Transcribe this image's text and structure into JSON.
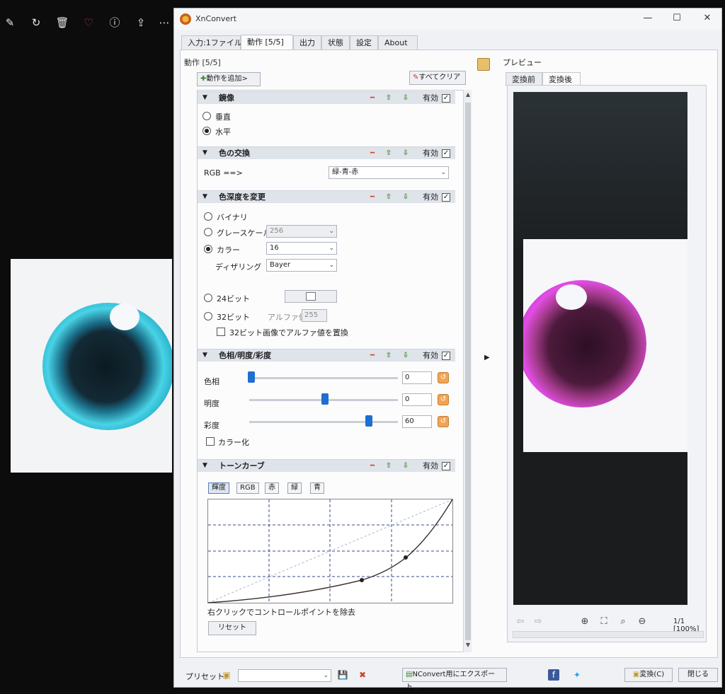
{
  "viewer": {
    "toolbar": [
      {
        "name": "edit-icon",
        "glyph": "✎"
      },
      {
        "name": "rotate-icon",
        "glyph": "↻"
      },
      {
        "name": "delete-icon",
        "glyph": "🗑"
      },
      {
        "name": "favorite-icon",
        "glyph": "♡"
      },
      {
        "name": "info-icon",
        "glyph": "ⓘ"
      },
      {
        "name": "share-icon",
        "glyph": "⇪"
      },
      {
        "name": "more-icon",
        "glyph": "⋯"
      }
    ]
  },
  "window": {
    "title": "XnConvert",
    "controls": {
      "minimize": "—",
      "maximize": "☐",
      "close": "✕"
    }
  },
  "tabs": [
    "入力:1ファイル",
    "動作 [5/5]",
    "出力",
    "状態",
    "設定",
    "About"
  ],
  "actions": {
    "group_label": "動作 [5/5]",
    "add_button": "動作を追加>",
    "clear_button": "すべてクリア",
    "enabled_label": "有効",
    "mirror": {
      "title": "鏡像",
      "options": [
        "垂直",
        "水平"
      ],
      "selected": "水平"
    },
    "swap": {
      "title": "色の交換",
      "label": "RGB ==>",
      "value": "緑-青-赤"
    },
    "depth": {
      "title": "色深度を変更",
      "binary": "バイナリ",
      "grayscale": "グレースケール",
      "grayscale_value": "256",
      "color": "カラー",
      "color_value": "16",
      "dithering_label": "ディザリング",
      "dithering_value": "Bayer",
      "bit24": "24ビット",
      "bit32": "32ビット",
      "alpha_label": "アルファ値",
      "alpha_value": "255",
      "replace_alpha": "32ビット画像でアルファ値を置換",
      "selected": "カラー"
    },
    "hsl": {
      "title": "色相/明度/彩度",
      "hue_label": "色相",
      "hue_value": "0",
      "lightness_label": "明度",
      "lightness_value": "0",
      "saturation_label": "彩度",
      "saturation_value": "60",
      "colorize": "カラー化"
    },
    "curves": {
      "title": "トーンカーブ",
      "channels": [
        "輝度",
        "RGB",
        "赤",
        "緑",
        "青"
      ],
      "active_channel": "輝度",
      "hint": "右クリックでコントロールポイントを除去",
      "reset": "リセット"
    }
  },
  "preview": {
    "label": "プレビュー",
    "tabs": [
      "変換前",
      "変換後"
    ],
    "active_tab": "変換後",
    "page_info": "1/1 [100%]"
  },
  "bottom": {
    "preset_label": "プリセット:",
    "export_button": "NConvert用にエクスポート...",
    "convert_button": "変換(C)",
    "close_button": "閉じる"
  },
  "colors": {
    "accent": "#1e6fd0",
    "header_bg": "#dfe3ea",
    "window_bg": "#f0f1f4"
  }
}
